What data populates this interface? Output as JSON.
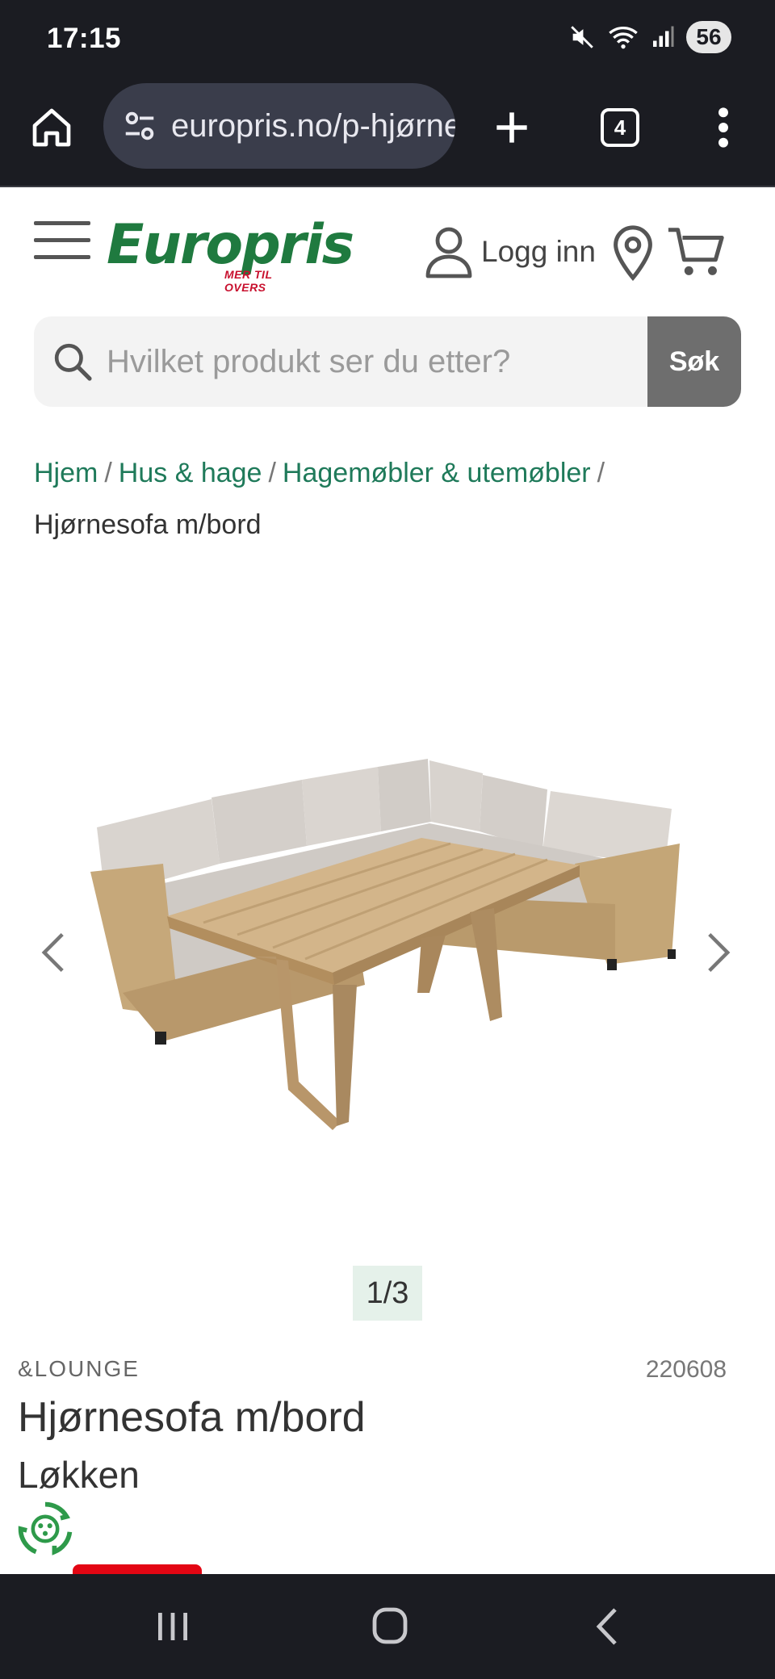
{
  "status_bar": {
    "time": "17:15",
    "battery": "56"
  },
  "browser": {
    "url": "europris.no/p-hjørnesofa",
    "tab_count": "4"
  },
  "header": {
    "logo_text": "Europris",
    "logo_tagline": "MER TIL OVERS",
    "login_label": "Logg inn"
  },
  "search": {
    "placeholder": "Hvilket produkt ser du etter?",
    "button_label": "Søk"
  },
  "breadcrumb": {
    "items": [
      "Hjem",
      "Hus & hage",
      "Hagemøbler & utemøbler"
    ],
    "separator": "/",
    "current": "Hjørnesofa m/bord"
  },
  "gallery": {
    "counter": "1/3",
    "current_index": 1,
    "total": 3
  },
  "product": {
    "brand": "&LOUNGE",
    "sku": "220608",
    "title": "Hjørnesofa m/bord",
    "subtitle": "Løkken"
  },
  "colors": {
    "brand_green": "#1f7a3f",
    "brand_red": "#c8102e",
    "chrome_dark": "#1b1c22",
    "search_button": "#6e6e6e",
    "counter_bg": "#e5f1ea"
  },
  "icons": [
    "home-icon",
    "site-settings-icon",
    "plus-icon",
    "tabs-icon",
    "more-vert-icon",
    "hamburger-icon",
    "user-icon",
    "location-pin-icon",
    "cart-icon",
    "search-icon",
    "chevron-left-icon",
    "chevron-right-icon",
    "eco-badge-icon"
  ]
}
